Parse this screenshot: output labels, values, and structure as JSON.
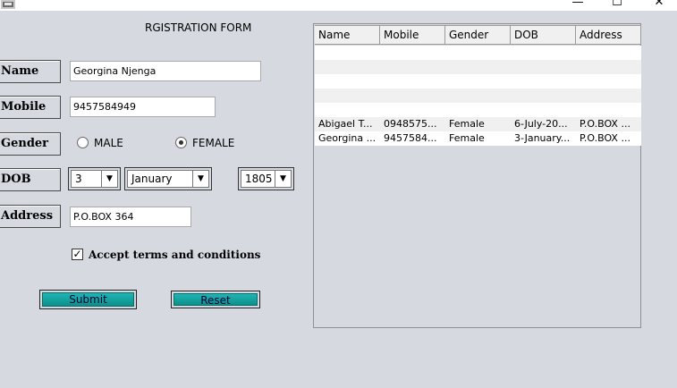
{
  "window": {
    "minimize": "—",
    "maximize": "☐",
    "close": "✕"
  },
  "form": {
    "title": "RGISTRATION FORM",
    "labels": {
      "name": "Name",
      "mobile": "Mobile",
      "gender": "Gender",
      "dob": "DOB",
      "address": "Address"
    },
    "name_value": "Georgina Njenga",
    "mobile_value": "9457584949",
    "gender": {
      "male": "MALE",
      "female": "FEMALE",
      "selected": "FEMALE"
    },
    "dob": {
      "day": "3",
      "month": "January",
      "year": "1805"
    },
    "address_value": "P.O.BOX 364",
    "terms": {
      "label": "Accept terms and conditions",
      "checked": true
    },
    "submit_label": "Submit",
    "reset_label": "Reset"
  },
  "table": {
    "columns": [
      "Name",
      "Mobile",
      "Gender",
      "DOB",
      "Address"
    ],
    "rows": [
      [
        "",
        "",
        "",
        "",
        ""
      ],
      [
        "",
        "",
        "",
        "",
        ""
      ],
      [
        "",
        "",
        "",
        "",
        ""
      ],
      [
        "",
        "",
        "",
        "",
        ""
      ],
      [
        "",
        "",
        "",
        "",
        ""
      ],
      [
        "Abigael T...",
        "0948575...",
        "Female",
        "6-July-20...",
        "P.O.BOX ..."
      ],
      [
        "Georgina ...",
        "9457584...",
        "Female",
        "3-January...",
        "P.O.BOX ..."
      ]
    ]
  },
  "colors": {
    "button_teal": "#17a4a2",
    "background": "#d6d9df"
  }
}
